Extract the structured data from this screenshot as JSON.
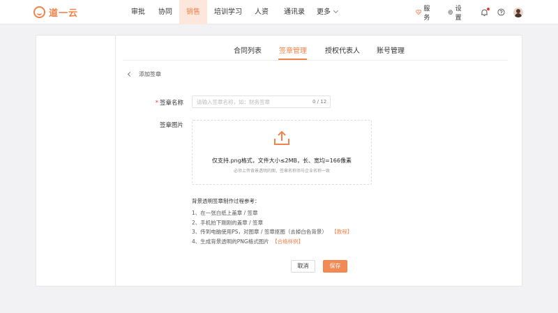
{
  "app": {
    "logo_text": "道一云"
  },
  "nav": {
    "items": [
      "审批",
      "协同",
      "销售",
      "培训学习",
      "人资",
      "通讯录",
      "更多"
    ],
    "active": "销售"
  },
  "topright": {
    "service": "服务",
    "settings": "设置"
  },
  "tabs": {
    "items": [
      "合同列表",
      "签章管理",
      "授权代表人",
      "账号管理"
    ],
    "active": "签章管理"
  },
  "back_label": "添加签章",
  "form": {
    "required_mark": "*",
    "name_label": "签章名称",
    "name_placeholder": "请输入签章名称，如：财务签章",
    "name_value": "",
    "name_counter": "0 / 12",
    "image_label": "签章图片"
  },
  "upload": {
    "main_text": "仅支持.png格式，文件大小≤2MB，长、宽均=166像素",
    "sub_text": "必须上传背景透明的图，签章名称须与企业名称一致"
  },
  "guide": {
    "title": "背景透明签章制作过程参考：",
    "steps": [
      "1、在一张白纸上盖章 / 签章",
      "2、手机拍下刚刚的盖章 / 签章",
      "3、传到电脑使用PS，对图章 / 签章抠图（去掉白色背景）",
      "4、生成背景透明的PNG格式图片"
    ],
    "link_tutorial": "【教程】",
    "link_sample": "【合格样例】"
  },
  "buttons": {
    "cancel": "取消",
    "save": "保存"
  },
  "colors": {
    "accent": "#f0824a",
    "nav_active_bg": "#fde7dc",
    "notification_dot": "#e53935"
  },
  "icons": [
    "logo-icon",
    "chevron-down-icon",
    "service-heart-icon",
    "gear-icon",
    "bell-icon",
    "help-icon",
    "avatar",
    "back-arrow-icon",
    "upload-icon"
  ]
}
